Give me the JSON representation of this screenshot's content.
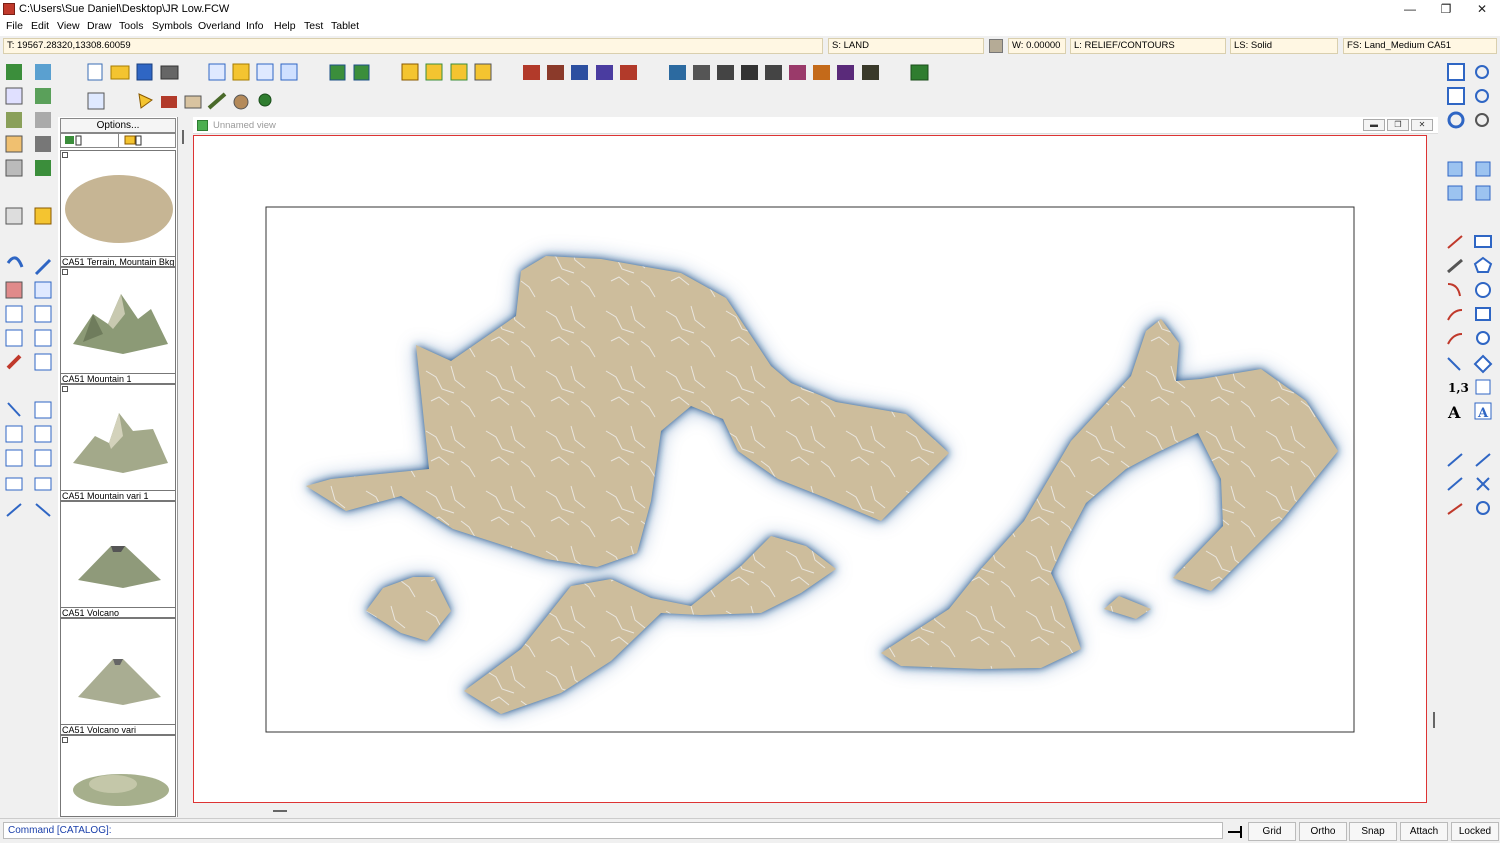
{
  "window": {
    "title": "C:\\Users\\Sue Daniel\\Desktop\\JR Low.FCW",
    "minimize": "—",
    "maximize": "❐",
    "close": "✕"
  },
  "menu": [
    "File",
    "Edit",
    "View",
    "Draw",
    "Tools",
    "Symbols",
    "Overland",
    "Info",
    "Help",
    "Test",
    "Tablet"
  ],
  "status": {
    "coords": "T: 19567.28320,13308.60059",
    "sheet": "S: LAND",
    "width": "W: 0.00000",
    "layer": "L: RELIEF/CONTOURS",
    "line_style": "LS: Solid",
    "fill_style": "FS: Land_Medium CA51"
  },
  "catalog": {
    "options_label": "Options...",
    "symbols": [
      {
        "label": "CA51 Terrain, Mountain Bkg"
      },
      {
        "label": "CA51 Mountain 1"
      },
      {
        "label": "CA51 Mountain vari 1"
      },
      {
        "label": "CA51 Volcano"
      },
      {
        "label": "CA51 Volcano vari"
      },
      {
        "label": ""
      }
    ]
  },
  "view": {
    "title": "Unnamed view"
  },
  "command": {
    "prompt": "Command [CATALOG]:"
  },
  "toggles": [
    "Grid",
    "Ortho",
    "Snap",
    "Attach",
    "Locked"
  ],
  "colors": {
    "accent_red": "#d33333",
    "land_fill": "#cdbd9c",
    "water_glow": "#1d4f86",
    "status_field_bg": "#fff7e3"
  }
}
